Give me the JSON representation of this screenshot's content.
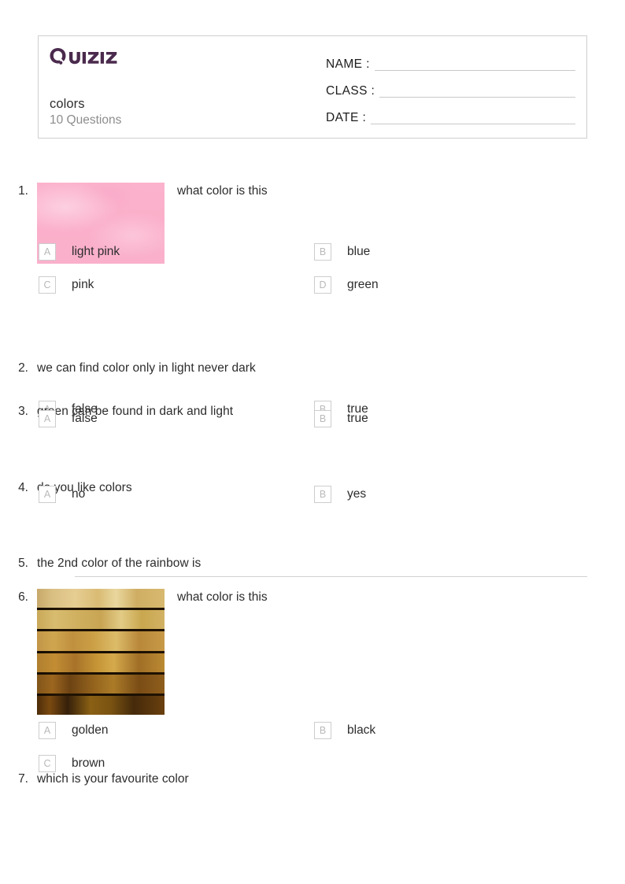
{
  "brand": {
    "logo_text": "Quizizz",
    "logo_color": "#4a2a4d",
    "logo_icon": "quizizz-logo"
  },
  "header": {
    "quiz_title": "colors",
    "question_count_label": "10 Questions",
    "fields": [
      {
        "label": "NAME :",
        "value": ""
      },
      {
        "label": "CLASS :",
        "value": ""
      },
      {
        "label": "DATE  :",
        "value": ""
      }
    ]
  },
  "questions": [
    {
      "number": "1.",
      "text": "what color is this",
      "has_image": true,
      "image_name": "pink-color-swatch",
      "image_color": "#fbb0cb",
      "type": "multiple-choice",
      "options": [
        {
          "letter": "A",
          "label": "light pink"
        },
        {
          "letter": "B",
          "label": "blue"
        },
        {
          "letter": "C",
          "label": "pink"
        },
        {
          "letter": "D",
          "label": "green"
        }
      ]
    },
    {
      "number": "2.",
      "text": "we can find color only in light never dark",
      "has_image": false,
      "type": "true-false",
      "options": [
        {
          "letter": "A",
          "label": "false"
        },
        {
          "letter": "B",
          "label": "true"
        }
      ]
    },
    {
      "number": "3.",
      "text": "green can be found in dark and light",
      "has_image": false,
      "type": "true-false",
      "options": [
        {
          "letter": "A",
          "label": "false"
        },
        {
          "letter": "B",
          "label": "true"
        }
      ]
    },
    {
      "number": "4.",
      "text": "do you like colors",
      "has_image": false,
      "type": "true-false",
      "options": [
        {
          "letter": "A",
          "label": "no"
        },
        {
          "letter": "B",
          "label": "yes"
        }
      ]
    },
    {
      "number": "5.",
      "text": "the 2nd color of the rainbow is",
      "has_image": false,
      "type": "open-response",
      "options": []
    },
    {
      "number": "6.",
      "text": "what color is this",
      "has_image": true,
      "image_name": "golden-color-swatch",
      "image_color": "#c9a259",
      "type": "multiple-choice",
      "options": [
        {
          "letter": "A",
          "label": "golden"
        },
        {
          "letter": "B",
          "label": "black"
        },
        {
          "letter": "C",
          "label": "brown"
        }
      ]
    },
    {
      "number": "7.",
      "text": "which is your favourite color",
      "has_image": false,
      "type": "multiple-choice",
      "options": []
    }
  ]
}
